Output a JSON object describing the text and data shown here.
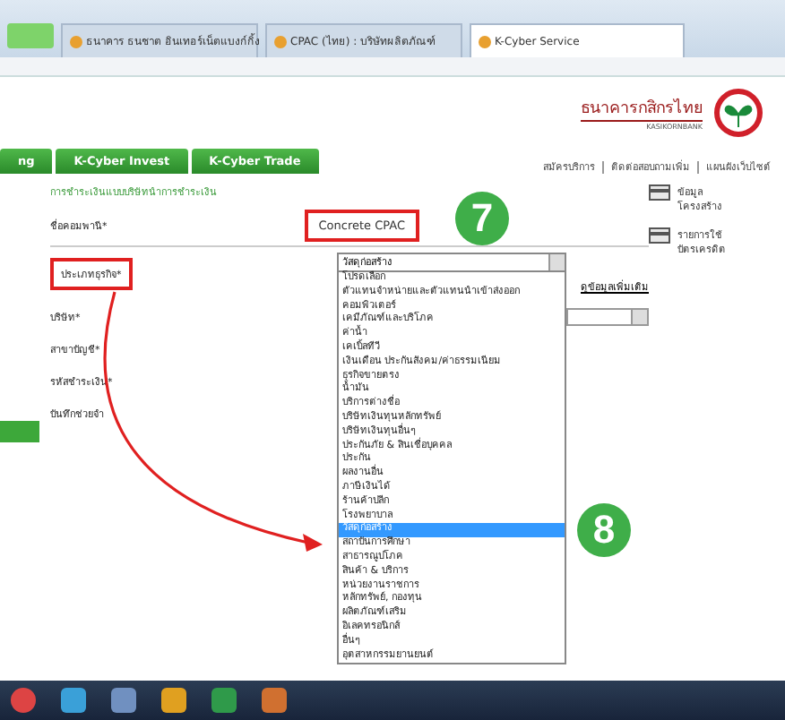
{
  "browser_tabs": [
    {
      "title": "ธนาคาร ธนชาต อินเทอร์เน็ตแบงก์กิ้ง",
      "selected": false
    },
    {
      "title": "CPAC (ไทย) : บริษัทผลิตภัณฑ์",
      "selected": false
    },
    {
      "title": "K-Cyber Service",
      "selected": true
    }
  ],
  "bank": {
    "name": "ธนาคารกสิกรไทย",
    "name_en": "KASIKORNBANK"
  },
  "nav_tabs": [
    {
      "label": "ng",
      "selected": false
    },
    {
      "label": "K-Cyber Invest",
      "selected": false
    },
    {
      "label": "K-Cyber Trade",
      "selected": false
    }
  ],
  "top_links": [
    "สมัครบริการ",
    "ติดต่อสอบถามเพิ่ม",
    "แผนผังเว็บไซต์"
  ],
  "form": {
    "title": "การชำระเงินแบบบริษัทนำการชำระเงิน",
    "company": {
      "label": "ชื่อคอมพานี*",
      "value": "Concrete CPAC"
    },
    "business_type": {
      "label": "ประเภทธุรกิจ*",
      "value": "วัสดุก่อสร้าง",
      "detail_link": "ดูข้อมูลเพิ่มเติม"
    },
    "fields": [
      "บริษัท*",
      "สาขาบัญชี*",
      "รหัสชำระเงิน*",
      "บันทึกช่วยจำ"
    ]
  },
  "dropdown_options": [
    {
      "label": "โปรดเลือก",
      "selected": false
    },
    {
      "label": "ตัวแทนจำหน่ายและตัวแทนนำเข้าส่งออก",
      "selected": false
    },
    {
      "label": "คอมพิวเตอร์",
      "selected": false
    },
    {
      "label": "เคมีภัณฑ์และบริโภค",
      "selected": false
    },
    {
      "label": "ค่าน้ำ",
      "selected": false
    },
    {
      "label": "เคเบิ้ลทีวี",
      "selected": false
    },
    {
      "label": "เงินเดือน ประกันสังคม/ค่าธรรมเนียม",
      "selected": false
    },
    {
      "label": "ธุรกิจขายตรง",
      "selected": false
    },
    {
      "label": "น้ำมัน",
      "selected": false
    },
    {
      "label": "บริการต่างชื่อ",
      "selected": false
    },
    {
      "label": "บริษัทเงินทุนหลักทรัพย์",
      "selected": false
    },
    {
      "label": "บริษัทเงินทุนอื่นๆ",
      "selected": false
    },
    {
      "label": "ประกันภัย & สินเชื่อบุคคล",
      "selected": false
    },
    {
      "label": "ประกัน",
      "selected": false
    },
    {
      "label": "ผลงานอื่น",
      "selected": false
    },
    {
      "label": "ภาษีเงินได้",
      "selected": false
    },
    {
      "label": "ร้านค้าปลีก",
      "selected": false
    },
    {
      "label": "โรงพยาบาล",
      "selected": false
    },
    {
      "label": "วัสดุก่อสร้าง",
      "selected": true
    },
    {
      "label": "สถาบันการศึกษา",
      "selected": false
    },
    {
      "label": "สาธารณูปโภค",
      "selected": false
    },
    {
      "label": "สินค้า & บริการ",
      "selected": false
    },
    {
      "label": "หน่วยงานราชการ",
      "selected": false
    },
    {
      "label": "หลักทรัพย์, กองทุน",
      "selected": false
    },
    {
      "label": "ผลิตภัณฑ์เสริม",
      "selected": false
    },
    {
      "label": "อิเลคทรอนิกส์",
      "selected": false
    },
    {
      "label": "อื่นๆ",
      "selected": false
    },
    {
      "label": "อุตสาหกรรมยานยนต์",
      "selected": false
    }
  ],
  "side_links": [
    "ข้อมูลโครงสร้าง",
    "รายการใช้ บัตรเครดิต"
  ],
  "annotations": [
    "7",
    "8"
  ]
}
